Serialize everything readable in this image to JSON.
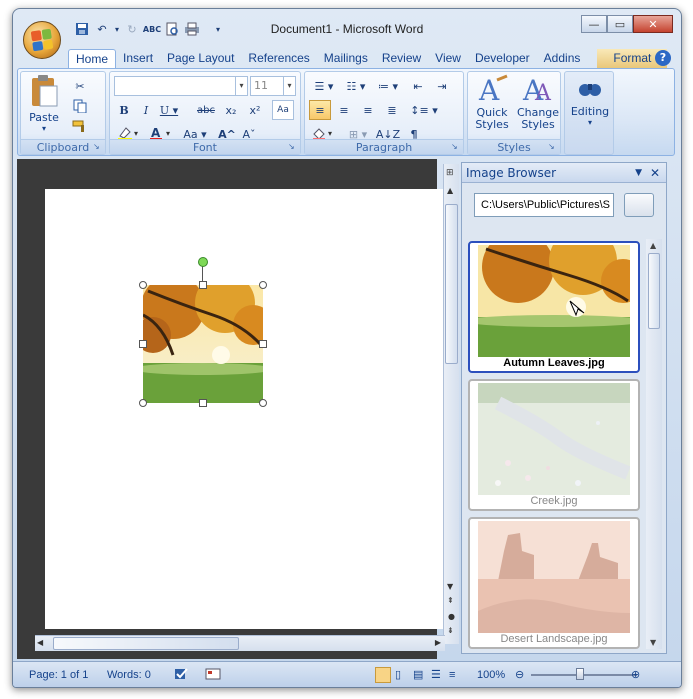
{
  "window": {
    "title": "Document1 - Microsoft Word",
    "controls": {
      "minimize": "—",
      "restore": "▭",
      "close": "✕"
    }
  },
  "quick_access": [
    "save-icon",
    "undo-icon",
    "redo-icon",
    "spelling-icon",
    "print-preview-icon",
    "print-icon",
    "customize-icon"
  ],
  "tabs": [
    {
      "label": "Home",
      "active": true
    },
    {
      "label": "Insert"
    },
    {
      "label": "Page Layout"
    },
    {
      "label": "References"
    },
    {
      "label": "Mailings"
    },
    {
      "label": "Review"
    },
    {
      "label": "View"
    },
    {
      "label": "Developer"
    },
    {
      "label": "Addins"
    },
    {
      "label": "Format"
    }
  ],
  "ribbon": {
    "clipboard": {
      "label": "Clipboard",
      "paste_label": "Paste"
    },
    "font": {
      "label": "Font",
      "font_name": "",
      "font_size": "11"
    },
    "paragraph": {
      "label": "Paragraph"
    },
    "styles": {
      "label": "Styles",
      "quick_styles": "Quick Styles",
      "change_styles": "Change Styles"
    },
    "editing": {
      "label": "Editing"
    }
  },
  "task_pane": {
    "title": "Image Browser",
    "path": "C:\\Users\\Public\\Pictures\\S",
    "images": [
      {
        "name": "Autumn Leaves.jpg",
        "selected": true
      },
      {
        "name": "Creek.jpg",
        "selected": false
      },
      {
        "name": "Desert Landscape.jpg",
        "selected": false
      }
    ]
  },
  "status": {
    "page": "Page: 1 of 1",
    "words": "Words: 0",
    "zoom": "100%"
  },
  "colors": {
    "accent": "#15428b",
    "selection_border": "#2b4fbd",
    "ribbon_border": "#8db2e3"
  }
}
